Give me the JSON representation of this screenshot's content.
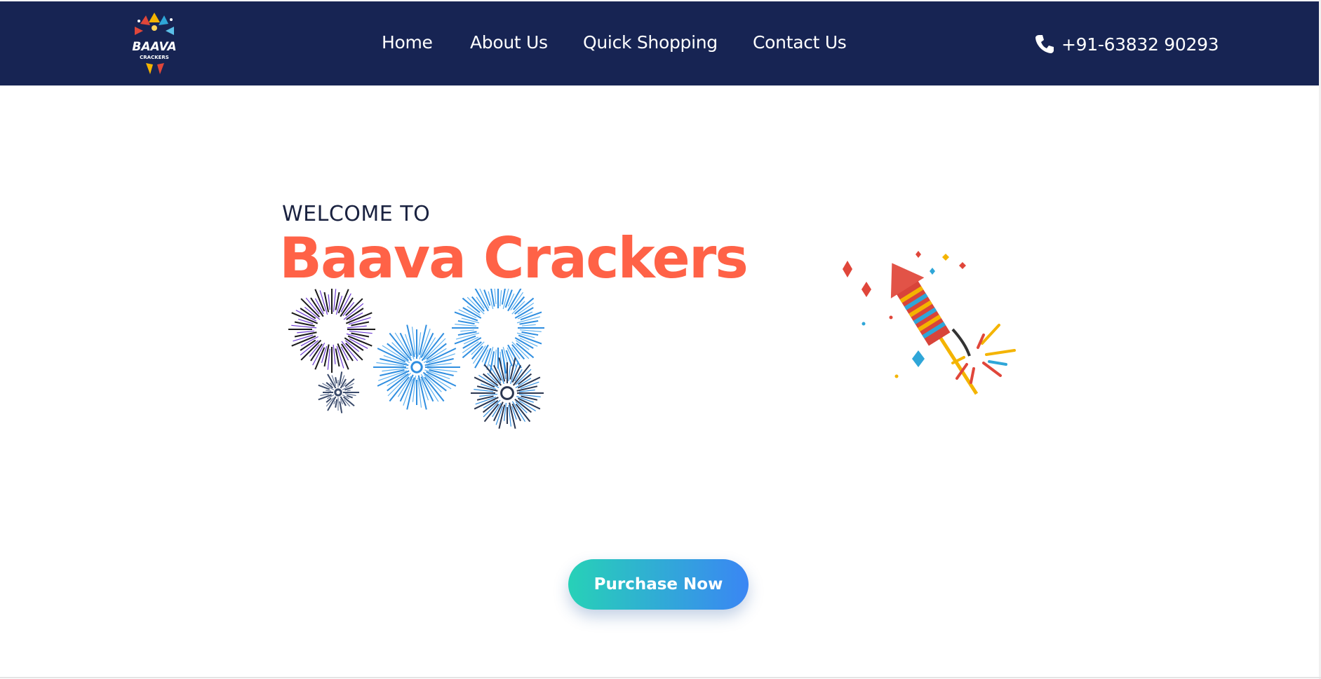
{
  "header": {
    "logo_text": "BAAVA",
    "logo_subtext": "CRACKERS",
    "nav": [
      {
        "label": "Home"
      },
      {
        "label": "About Us"
      },
      {
        "label": "Quick Shopping"
      },
      {
        "label": "Contact Us"
      }
    ],
    "phone": "+91-63832 90293",
    "colors": {
      "background": "#172453",
      "text": "#ffffff"
    }
  },
  "hero": {
    "welcome": "WELCOME TO",
    "title": "Baava Crackers",
    "cta_label": "Purchase Now",
    "colors": {
      "title": "#ff6247",
      "cta_start": "#27d1b7",
      "cta_end": "#3a86f4"
    },
    "illustrations": [
      "fireworks-illustration",
      "rocket-cracker-illustration"
    ]
  }
}
